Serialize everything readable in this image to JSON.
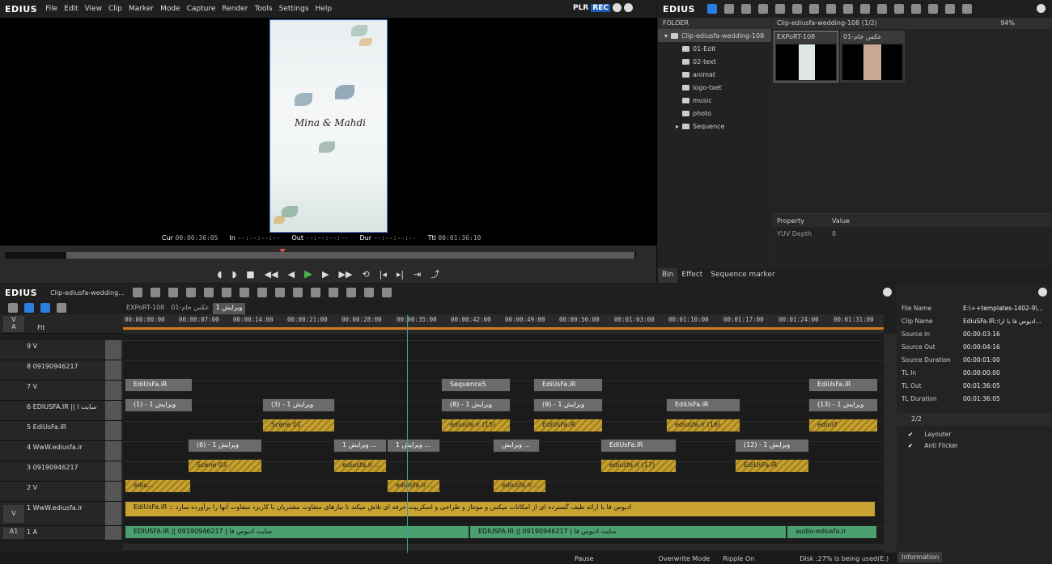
{
  "player": {
    "logo": "EDIUS",
    "menu": [
      "File",
      "Edit",
      "View",
      "Clip",
      "Marker",
      "Mode",
      "Capture",
      "Render",
      "Tools",
      "Settings",
      "Help"
    ],
    "plr": "PLR",
    "rec": "REC",
    "timecodes": [
      {
        "label": "Cur",
        "value": "00:00:36:05"
      },
      {
        "label": "In",
        "value": "--:--:--:--"
      },
      {
        "label": "Out",
        "value": "--:--:--:--"
      },
      {
        "label": "Dur",
        "value": "--:--:--:--"
      },
      {
        "label": "Ttl",
        "value": "00:01:36:10"
      }
    ],
    "script_text": "Mina & Mahdi"
  },
  "bin": {
    "logo": "EDIUS",
    "folder_label": "FOLDER",
    "folders": [
      {
        "label": "Clip-ediusfa-wedding-108",
        "level": 0,
        "selected": true
      },
      {
        "label": "01-Edit",
        "level": 1
      },
      {
        "label": "02-text",
        "level": 1
      },
      {
        "label": "animat",
        "level": 1
      },
      {
        "label": "logo-txet",
        "level": 1
      },
      {
        "label": "music",
        "level": 1
      },
      {
        "label": "photo",
        "level": 1
      },
      {
        "label": "Sequence",
        "level": 1
      }
    ],
    "clip_path": "Clip-ediusfa-wedding-108 (1/2)",
    "zoom": "94%",
    "clips": [
      {
        "title": "EXPoRT-108"
      },
      {
        "title": "عکس خام-01"
      }
    ],
    "props_head": {
      "k": "Property",
      "v": "Value"
    },
    "props": [
      {
        "k": "YUV Depth",
        "v": "8"
      }
    ],
    "tabs": [
      "Bin",
      "Effect",
      "Sequence marker"
    ]
  },
  "timeline": {
    "logo": "EDIUS",
    "seq_name": "Clip-ediusfa-wedding...",
    "seq_tabs": [
      "EXPoRT-108",
      "عکس خام-01",
      "ویرایش 1"
    ],
    "fit": "Fit",
    "ruler": [
      "00:00:00:00",
      "00:00:07:00",
      "00:00:14:00",
      "00:00:21:00",
      "00:00:28:00",
      "00:00:35:00",
      "00:00:42:00",
      "00:00:49:00",
      "00:00:56:00",
      "00:01:03:00",
      "00:01:10:00",
      "00:01:17:00",
      "00:01:24:00",
      "00:01:31:00"
    ],
    "tracks": [
      {
        "va": "",
        "name": "9 V"
      },
      {
        "va": "",
        "name": "8 09190946217"
      },
      {
        "va": "",
        "name": "7 V"
      },
      {
        "va": "",
        "name": "6 EDIUSFA.IR || سایت ا"
      },
      {
        "va": "",
        "name": "5 EdiUsFa.iR"
      },
      {
        "va": "",
        "name": "4 WwW.ediusfa.ir"
      },
      {
        "va": "",
        "name": "3 09190946217"
      },
      {
        "va": "",
        "name": "2 V"
      },
      {
        "va": "V",
        "name": "1 WwW.ediusfa.ir"
      },
      {
        "va": "A1",
        "name": "1 A"
      }
    ],
    "clips": {
      "c1": "EdiUsFa.iR",
      "c2": "Sequence5",
      "c3": "EdiUsFa.iR",
      "c4": "EdiUsFa.iR",
      "c5": "ویرایش 1 - (1)",
      "c6": "ویرایش 1 - (3)",
      "c7": "ویرایش 1 - (8)",
      "c8": "ویرایش 1 - (9)",
      "c9": "EdiUsFa.iR",
      "c10": "ویرایش 1 - (13)",
      "c11": "Scene 01",
      "c12": "ediusfa.ir (15)",
      "c13": "EdiUsFa.iR",
      "c14": "ediusfa.ir (16)",
      "c15": "ediusf",
      "c16": "ویرایش 1 - (6)",
      "c17": "ویرایش 1 ...",
      "c18": "ویرایش 1 ...",
      "c19": "ویرایش ...",
      "c20": "EdiUsFa.iR",
      "c21": "ویرایش 1 - (12)",
      "c22": "Scene 03",
      "c23": "ediusfa.ir ...",
      "c24": "ediusfa.ir (17)",
      "c25": "EdiUsFa.iR",
      "c26": "ediu...",
      "c27": "ediusfa.ir ...",
      "c28": "ediusfa.ir ...",
      "c29": "EdiUsFa.iR :: ادیوس فا با ارائه طیف گسترده ای از امکانات میکس و مونتاژ و طراحی و اسکریپت حرفه ای تلاش میکند تا نیازهای متفاوت مشتریان با کاربرد متفاوت آنها را برآورده سازد",
      "c30": "EDIUSFA.IR || 09190946217 | سایت ادیوس فا",
      "c31": "EDIUSFA.IR || 09190946217 | سایت ادیوس فا",
      "c32": "audio-ediusfa.ir"
    },
    "status": {
      "pause": "Pause",
      "mode": "Overwrite Mode",
      "ripple": "Ripple On",
      "disk": "Disk :27% is being used(E:)"
    }
  },
  "info": {
    "rows": [
      {
        "k": "File Name",
        "v": "E:\\++templates-1402-9\\..."
      },
      {
        "k": "Clip Name",
        "v": "EdiuSFa.IR::ادیوس فا با ارا..."
      },
      {
        "k": "Source In",
        "v": "00:00:03:16"
      },
      {
        "k": "Source Out",
        "v": "00:00:04:16"
      },
      {
        "k": "Source Duration",
        "v": "00:00:01:00"
      },
      {
        "k": "TL In",
        "v": "00:00:00:00"
      },
      {
        "k": "TL Out",
        "v": "00:01:36:05"
      },
      {
        "k": "TL Duration",
        "v": "00:01:36:05"
      }
    ],
    "count": "2/2",
    "effects": [
      "Layouter",
      "Anti Flicker"
    ],
    "tab": "Information"
  }
}
